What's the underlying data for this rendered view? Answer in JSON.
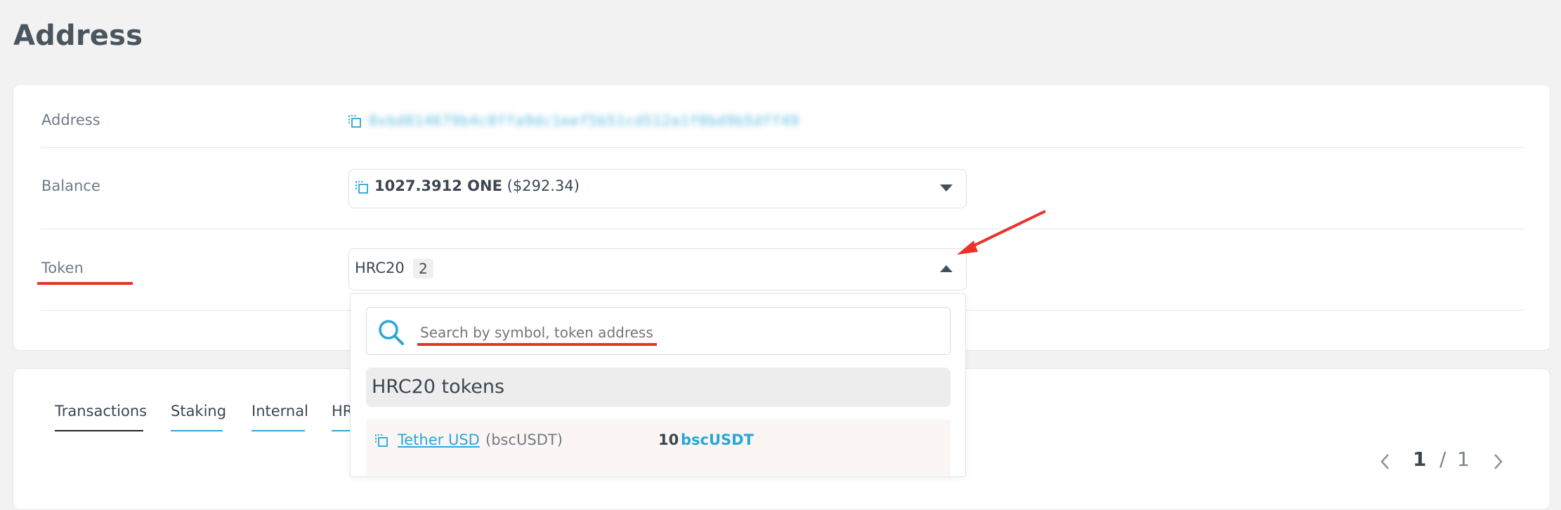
{
  "page": {
    "title": "Address"
  },
  "details": {
    "address_label": "Address",
    "address_value": "0xbd814679b4c0ffa9dc1eef5b51cd512a1f0bd9b5dff49",
    "balance_label": "Balance",
    "balance_amount": "1027.3912 ONE",
    "balance_usd": "($292.34)",
    "token_label": "Token",
    "token_type": "HRC20",
    "token_count": "2"
  },
  "token_dropdown": {
    "search_placeholder": "Search by symbol, token address",
    "group_title": "HRC20 tokens",
    "items": [
      {
        "name": "Tether USD",
        "symbol": "(bscUSDT)",
        "amount": "10",
        "amount_symbol": "bscUSDT"
      }
    ]
  },
  "tabs": {
    "items": [
      "Transactions",
      "Staking",
      "Internal",
      "HR"
    ],
    "active_index": 0
  },
  "pagination": {
    "current": "1",
    "separator": "/",
    "total": "1"
  },
  "colors": {
    "accent": "#2aa6d5",
    "annotation": "#e8322a"
  },
  "icons": [
    "copy-icon",
    "search-icon",
    "chevron-down-icon",
    "chevron-up-icon",
    "chevron-left-icon",
    "chevron-right-icon"
  ]
}
